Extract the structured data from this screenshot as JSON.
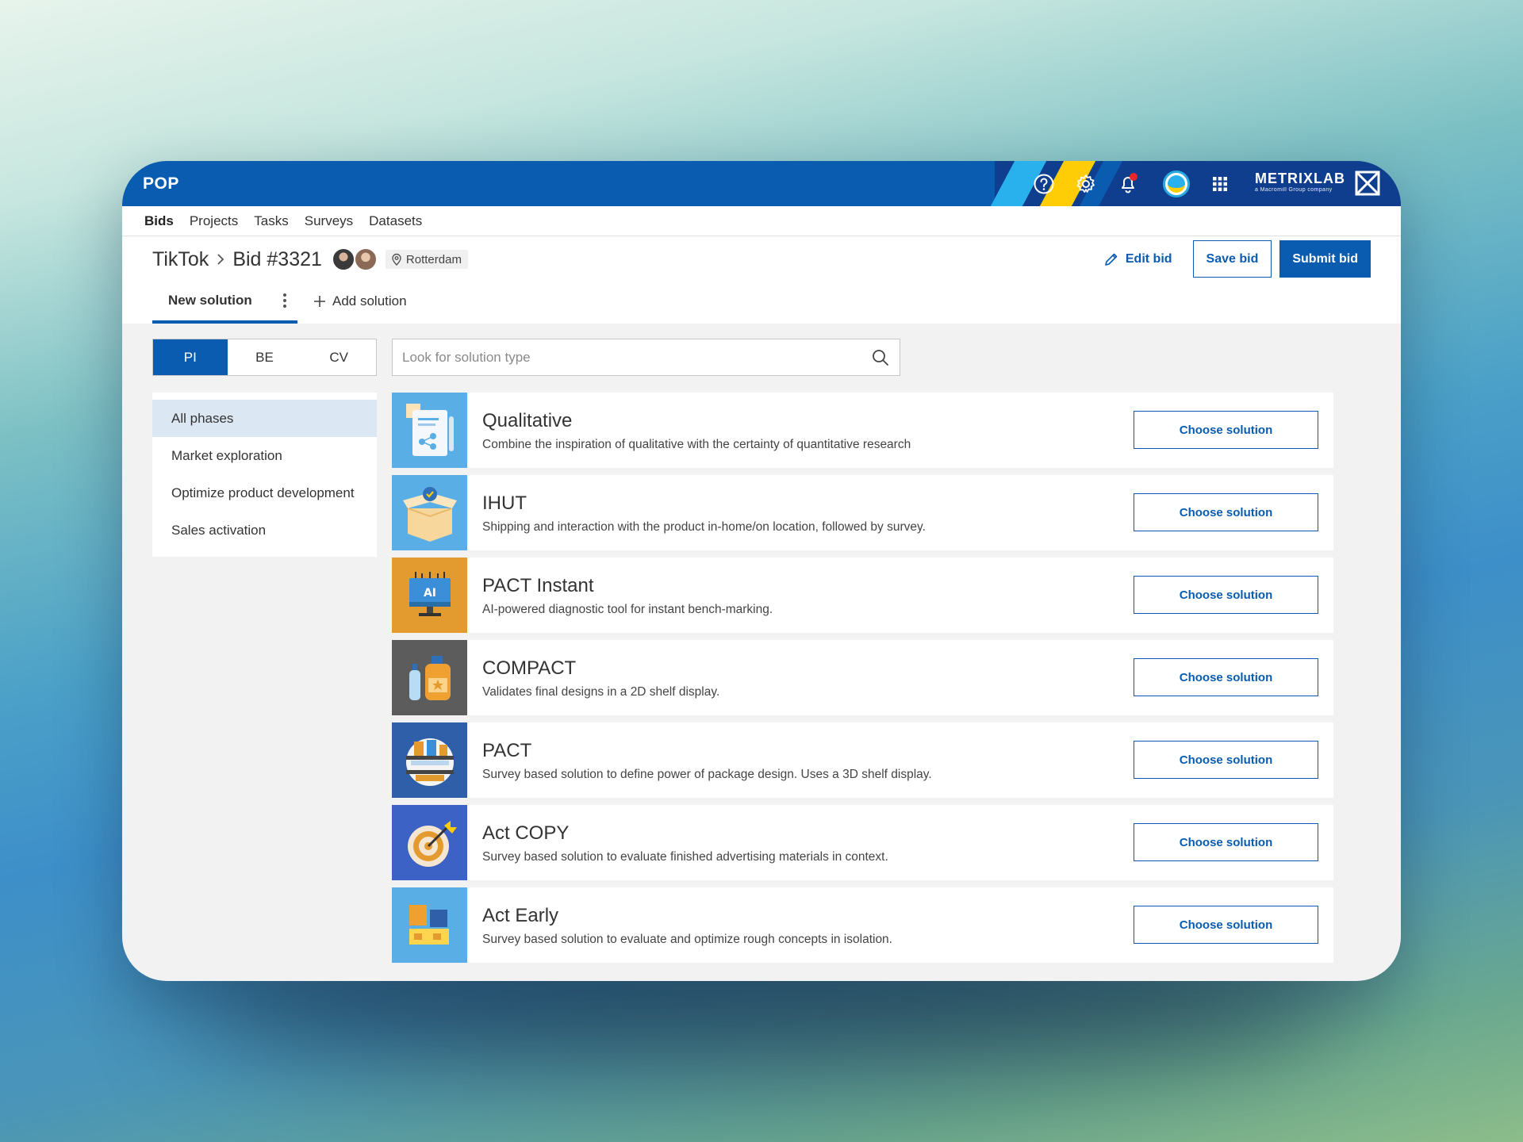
{
  "app": {
    "title": "POP"
  },
  "header": {
    "icons": [
      "help-icon",
      "gear-icon",
      "bell-icon",
      "user-avatar",
      "apps-grid-icon"
    ],
    "brand_name": "METRIXLAB",
    "brand_sub": "a Macromill Group company",
    "colors": {
      "primary": "#0a5cb1",
      "dark": "#0f3e8f",
      "cyan": "#29b1ee",
      "yellow": "#ffcd05"
    }
  },
  "nav": {
    "items": [
      "Bids",
      "Projects",
      "Tasks",
      "Surveys",
      "Datasets"
    ],
    "active": "Bids"
  },
  "breadcrumb": {
    "client": "TikTok",
    "bid": "Bid #3321"
  },
  "location": "Rotterdam",
  "actions": {
    "edit": "Edit bid",
    "save": "Save bid",
    "submit": "Submit bid"
  },
  "tabs": {
    "active": "New solution",
    "add": "Add solution"
  },
  "segments": {
    "items": [
      "PI",
      "BE",
      "CV"
    ],
    "active": "PI"
  },
  "search": {
    "placeholder": "Look for solution type",
    "value": ""
  },
  "phases": {
    "items": [
      "All phases",
      "Market exploration",
      "Optimize product development",
      "Sales activation"
    ],
    "active": "All phases"
  },
  "solutions": [
    {
      "title": "Qualitative",
      "desc": "Combine the inspiration of qualitative with the certainty of quantitative research",
      "button": "Choose solution",
      "icon": "document-network-icon",
      "bg": "#5aaee6"
    },
    {
      "title": "IHUT",
      "desc": "Shipping and interaction with the product in-home/on location, followed by survey.",
      "button": "Choose solution",
      "icon": "open-box-icon",
      "bg": "#5aaee6"
    },
    {
      "title": "PACT Instant",
      "desc": "AI-powered diagnostic tool for instant bench-marking.",
      "button": "Choose solution",
      "icon": "ai-monitor-icon",
      "bg": "#e39a2f"
    },
    {
      "title": "COMPACT",
      "desc": "Validates final designs in a 2D shelf display.",
      "button": "Choose solution",
      "icon": "bottles-icon",
      "bg": "#5c5c5c"
    },
    {
      "title": "PACT",
      "desc": "Survey based solution to define power of package design. Uses a 3D shelf display.",
      "button": "Choose solution",
      "icon": "shelf-icon",
      "bg": "#2f5fa8"
    },
    {
      "title": "Act COPY",
      "desc": "Survey based solution to evaluate finished advertising materials in context.",
      "button": "Choose solution",
      "icon": "target-icon",
      "bg": "#3b62c4"
    },
    {
      "title": "Act Early",
      "desc": "Survey based solution to evaluate and optimize rough concepts in isolation.",
      "button": "Choose solution",
      "icon": "blocks-icon",
      "bg": "#5aaee6"
    }
  ]
}
